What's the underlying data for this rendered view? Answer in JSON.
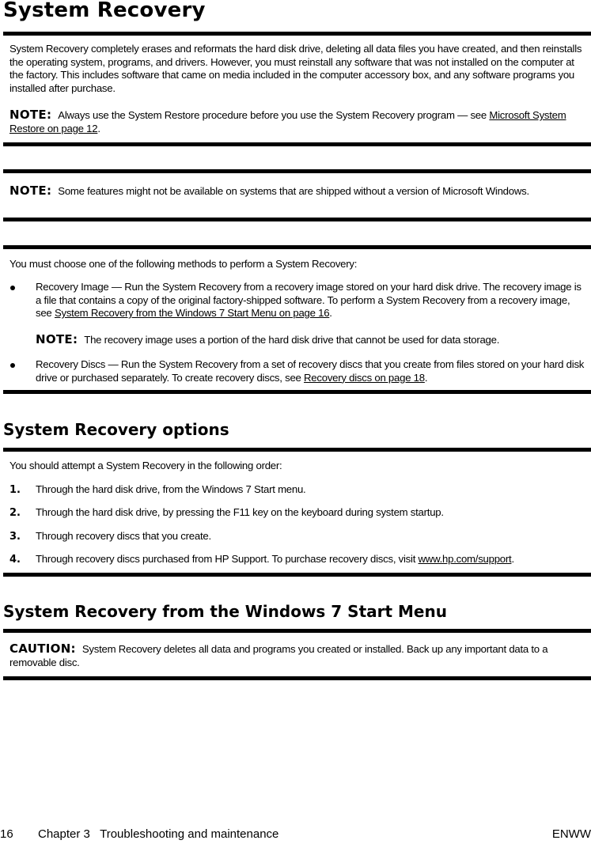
{
  "page": {
    "title": "System Recovery",
    "intro": "System Recovery completely erases and reformats the hard disk drive, deleting all data files you have created, and then reinstalls the operating system, programs, and drivers. However, you must reinstall any software that was not installed on the computer at the factory. This includes software that came on media included in the computer accessory box, and any software programs you installed after purchase.",
    "note1": {
      "label": "NOTE:",
      "text": "Always use the System Restore procedure before you use the System Recovery program — see ",
      "link": "Microsoft System Restore on page 12",
      "after": "."
    },
    "note2": {
      "label": "NOTE:",
      "text": "Some features might not be available on systems that are shipped without a version of Microsoft Windows."
    },
    "methods_intro": "You must choose one of the following methods to perform a System Recovery:",
    "methods": [
      {
        "text": "Recovery Image — Run the System Recovery from a recovery image stored on your hard disk drive. The recovery image is a file that contains a copy of the original factory-shipped software. To perform a System Recovery from a recovery image, see ",
        "link": "System Recovery from the Windows 7 Start Menu on page 16",
        "after": ".",
        "note_label": "NOTE:",
        "note_text": "The recovery image uses a portion of the hard disk drive that cannot be used for data storage."
      },
      {
        "text": "Recovery Discs — Run the System Recovery from a set of recovery discs that you create from files stored on your hard disk drive or purchased separately. To create recovery discs, see ",
        "link": "Recovery discs on page 18",
        "after": "."
      }
    ],
    "options": {
      "title": "System Recovery options",
      "intro": "You should attempt a System Recovery in the following order:",
      "steps": [
        {
          "num": "1.",
          "text": "Through the hard disk drive, from the Windows 7 Start menu."
        },
        {
          "num": "2.",
          "text": "Through the hard disk drive, by pressing the F11 key on the keyboard during system startup."
        },
        {
          "num": "3.",
          "text": "Through recovery discs that you create."
        },
        {
          "num": "4.",
          "text": "Through recovery discs purchased from HP Support. To purchase recovery discs, visit ",
          "link": "www.hp.com/support",
          "after": "."
        }
      ]
    },
    "start_menu": {
      "title": "System Recovery from the Windows 7 Start Menu",
      "caution_label": "CAUTION:",
      "caution_text": "System Recovery deletes all data and programs you created or installed. Back up any important data to a removable disc."
    },
    "footer": {
      "page_number": "16",
      "chapter": "Chapter 3   Troubleshooting and maintenance",
      "locale": "ENWW"
    }
  }
}
